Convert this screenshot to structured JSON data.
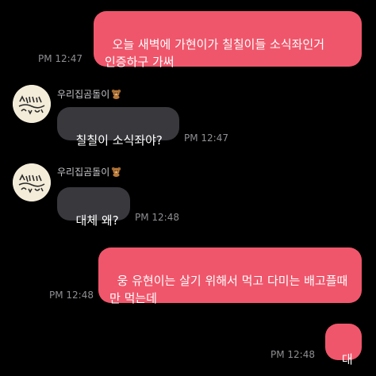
{
  "colors": {
    "background": "#000000",
    "outgoing_bubble": "#f0566b",
    "incoming_bubble": "#38383d",
    "timestamp": "#8e8e93"
  },
  "messages": [
    {
      "direction": "outgoing",
      "text": "오늘 새벽에 가현이가 칠칠이들 소식좌인거 인증하구 가써",
      "time": "PM 12:47"
    },
    {
      "direction": "incoming",
      "sender": "우리집곰돌이",
      "sender_icon": "teddy-bear-emoji",
      "text": "칠칠이 소식좌야?",
      "time": "PM 12:47"
    },
    {
      "direction": "incoming",
      "sender": "우리집곰돌이",
      "sender_icon": "teddy-bear-emoji",
      "text": "대체 왜?",
      "time": "PM 12:48"
    },
    {
      "direction": "outgoing",
      "text": "웅 유현이는 살기 위해서 먹고 다미는 배고플때 만 먹는데",
      "time": "PM 12:48"
    },
    {
      "direction": "outgoing",
      "text": "대",
      "time": "PM 12:48"
    }
  ]
}
